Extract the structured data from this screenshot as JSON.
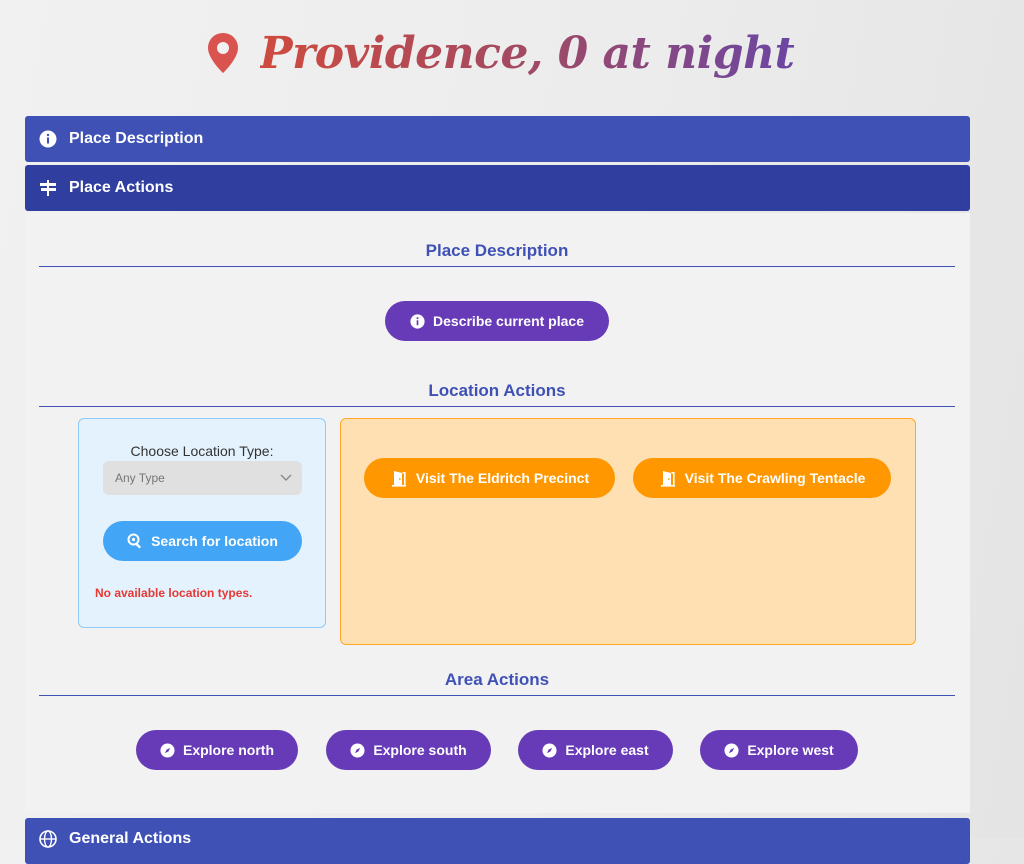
{
  "header": {
    "title": "Providence, 0 at night"
  },
  "accordion": {
    "place_description": "Place Description",
    "place_actions": "Place Actions",
    "general_actions": "General Actions"
  },
  "sections": {
    "description_title": "Place Description",
    "location_title": "Location Actions",
    "area_title": "Area Actions"
  },
  "buttons": {
    "describe": "Describe current place",
    "search": "Search for location"
  },
  "location": {
    "choose_label": "Choose Location Type:",
    "select_value": "Any Type",
    "error": "No available location types.",
    "visits": [
      "Visit The Eldritch Precinct",
      "Visit The Crawling Tentacle"
    ]
  },
  "area": {
    "explore": [
      "Explore north",
      "Explore south",
      "Explore east",
      "Explore west"
    ]
  },
  "colors": {
    "primary": "#3f51b5",
    "accent_purple": "#673ab7",
    "search_blue": "#42a5f5",
    "visit_orange": "#ff9800",
    "error_red": "#e53935"
  }
}
